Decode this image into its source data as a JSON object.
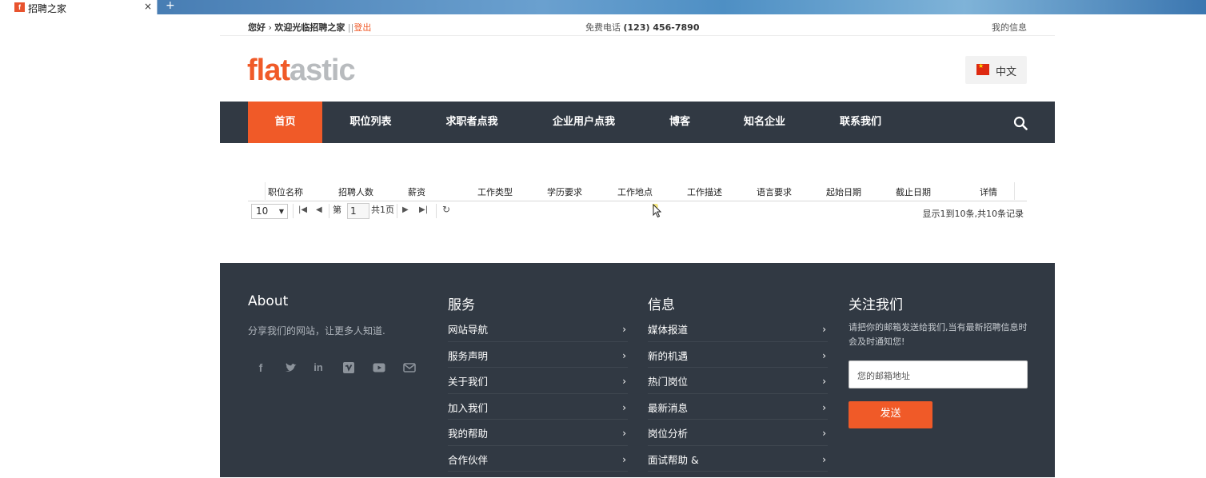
{
  "browser": {
    "tab_title": "招聘之家",
    "favicon_letter": "f",
    "close_glyph": "×",
    "new_tab_glyph": "+"
  },
  "topbar": {
    "greeting": "您好",
    "bullet": "›",
    "welcome": "欢迎光临招聘之家",
    "separator": "||",
    "logout": "登出",
    "phone_label": "免费电话",
    "phone_number": "(123) 456-7890",
    "my_info": "我的信息"
  },
  "header": {
    "logo_part1": "flat",
    "logo_part2": "astic",
    "language": "中文"
  },
  "nav": {
    "items": [
      "首页",
      "职位列表",
      "求职者点我",
      "企业用户点我",
      "博客",
      "知名企业",
      "联系我们"
    ],
    "active_index": 0
  },
  "grid": {
    "columns": [
      "职位名称",
      "招聘人数",
      "薪资",
      "工作类型",
      "学历要求",
      "工作地点",
      "工作描述",
      "语言要求",
      "起始日期",
      "截止日期",
      "详情"
    ],
    "rows": []
  },
  "pager": {
    "page_size": "10",
    "page_prefix": "第",
    "page_value": "1",
    "page_suffix": "共1页",
    "summary": "显示1到10条,共10条记录"
  },
  "footer": {
    "about": {
      "title": "About",
      "text": "分享我们的网站，让更多人知道."
    },
    "social_icons": [
      "facebook-icon",
      "twitter-icon",
      "linkedin-icon",
      "vimeo-icon",
      "youtube-icon",
      "mail-icon"
    ],
    "services": {
      "title": "服务",
      "items": [
        "网站导航",
        "服务声明",
        "关于我们",
        "加入我们",
        "我的帮助",
        "合作伙伴"
      ]
    },
    "info": {
      "title": "信息",
      "items": [
        "媒体报道",
        "新的机遇",
        "热门岗位",
        "最新消息",
        "岗位分析",
        "面试帮助 &"
      ]
    },
    "follow": {
      "title": "关注我们",
      "text": "请把你的邮箱发送给我们,当有最新招聘信息时会及时通知您!",
      "email_placeholder": "您的邮箱地址",
      "send_label": "发送"
    }
  },
  "colors": {
    "accent": "#f05a28",
    "dark": "#313943",
    "logo_grey": "#b8bbbe"
  }
}
